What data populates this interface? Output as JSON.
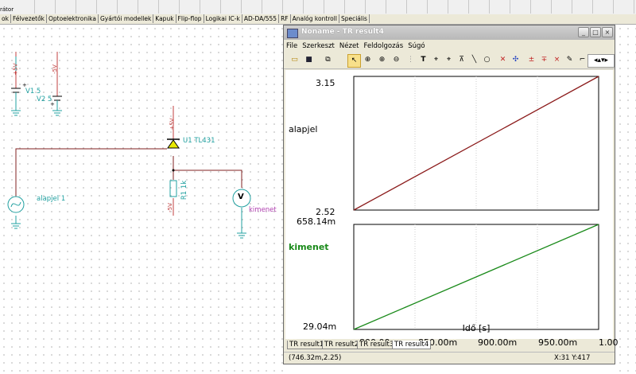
{
  "toolbar": {
    "first_label": "rátor",
    "button_count": 30
  },
  "component_tabs": [
    "ok",
    "Félvezetők",
    "Optoelektronika",
    "Gyártói modellek",
    "Kapuk",
    "Flip-flop",
    "Logikai IC-k",
    "AD-DA/555",
    "RF",
    "Analóg kontroll",
    "Speciális"
  ],
  "schematic": {
    "v1_name": "V1 5",
    "v1_value": "+5V",
    "v2_name": "V2 5",
    "v2_value": "-5V",
    "u1_name": "U1 TL431",
    "u1_supply": "+5V",
    "r1_name": "R1 1k",
    "r1_supply": "-5V",
    "source_name": "alapjel 1",
    "meter_name": "kimenet",
    "meter_symbol": "V",
    "plus_sign": "+"
  },
  "window": {
    "title": "Noname - TR result4",
    "controls": [
      "_",
      "□",
      "×"
    ],
    "menu": [
      "File",
      "Szerkeszt",
      "Nézet",
      "Feldolgozás",
      "Súgó"
    ]
  },
  "toolbar_icons": [
    "open-icon",
    "save-icon",
    "copy-icon",
    "pointer-icon",
    "zoom-in-icon",
    "zoom-in2-icon",
    "zoom-out-icon",
    "grid-icon",
    "text-icon",
    "cursor-a-icon",
    "cursor-b-icon",
    "marker-icon",
    "line-icon",
    "circle-icon",
    "tangent-icon",
    "crosshair-icon",
    "add-icon",
    "subtract-icon",
    "multiply-icon",
    "probe-icon",
    "angle-icon",
    "arrows-icon"
  ],
  "chart_data": [
    {
      "type": "line",
      "series": [
        {
          "name": "alapjel",
          "color": "#8b1a1a",
          "x": [
            0.8,
            1.0
          ],
          "y": [
            2.52,
            3.15
          ]
        }
      ],
      "y_ticks": [
        "3.15",
        "2.52"
      ],
      "ylim": [
        2.52,
        3.15
      ],
      "xlim": [
        0.8,
        1.0
      ],
      "grid": true
    },
    {
      "type": "line",
      "series": [
        {
          "name": "kimenet",
          "color": "#1a8a1a",
          "x": [
            0.8,
            1.0
          ],
          "y": [
            0.02904,
            0.65814
          ]
        }
      ],
      "y_ticks": [
        "658.14m",
        "29.04m"
      ],
      "ylim": [
        0.02904,
        0.65814
      ],
      "xlim": [
        0.8,
        1.0
      ],
      "x_ticks": [
        "800.00m",
        "850.00m",
        "900.00m",
        "950.00m",
        "1.00"
      ],
      "xlabel": "Idő [s]",
      "grid": true
    }
  ],
  "result_tabs": [
    "TR result1",
    "TR result2",
    "TR result3",
    "TR result4"
  ],
  "active_tab": "TR result4",
  "status": {
    "left": "(746.32m,2.25)",
    "right": "X:31  Y:417"
  }
}
